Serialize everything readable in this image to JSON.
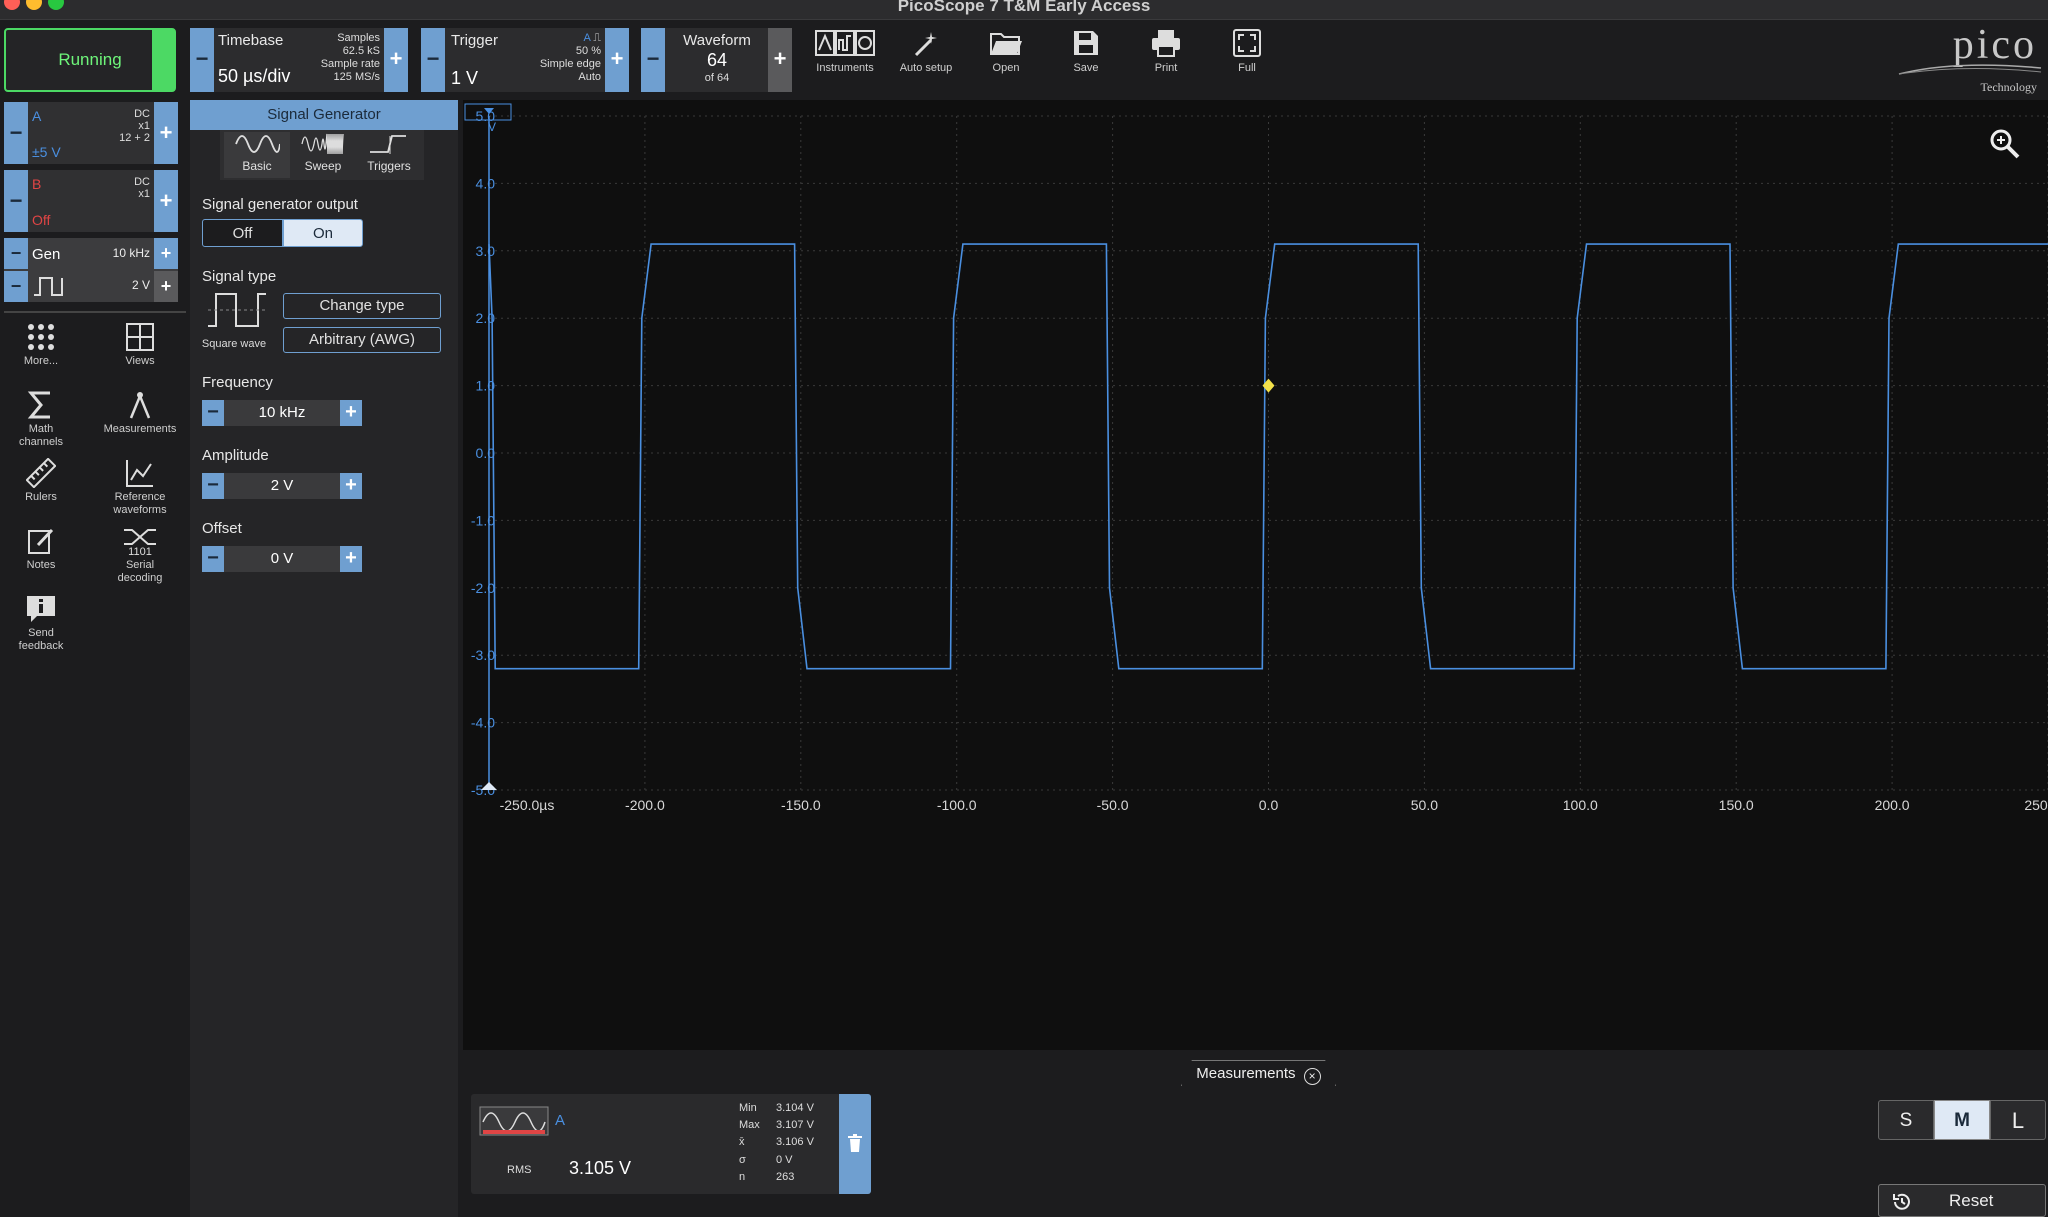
{
  "window": {
    "title": "PicoScope 7 T&M Early Access"
  },
  "toolbar": {
    "run_label": "Running",
    "timebase": {
      "title": "Timebase",
      "value": "50 µs/div",
      "samples_label": "Samples",
      "samples_value": "62.5 kS",
      "rate_label": "Sample rate",
      "rate_value": "125 MS/s"
    },
    "trigger": {
      "title": "Trigger",
      "value": "1 V",
      "channel": "A",
      "percent": "50 %",
      "type": "Simple edge",
      "mode": "Auto"
    },
    "waveform": {
      "title": "Waveform",
      "value": "64",
      "of": "of 64"
    },
    "tools": [
      {
        "label": "Instruments",
        "icon": "instruments-icon"
      },
      {
        "label": "Auto setup",
        "icon": "auto-setup-icon"
      },
      {
        "label": "Open",
        "icon": "open-folder-icon"
      },
      {
        "label": "Save",
        "icon": "save-icon"
      },
      {
        "label": "Print",
        "icon": "print-icon"
      },
      {
        "label": "Full",
        "icon": "fullscreen-icon"
      }
    ],
    "logo_text": "pico",
    "logo_sub": "Technology"
  },
  "channels": {
    "a": {
      "name": "A",
      "coupling": "DC",
      "probe": "x1",
      "res": "12 + 2",
      "range": "±5 V",
      "color": "#4a8fe0"
    },
    "b": {
      "name": "B",
      "coupling": "DC",
      "probe": "x1",
      "range": "Off",
      "color": "#e04545"
    },
    "gen": {
      "name": "Gen",
      "freq": "10 kHz",
      "amp": "2 V"
    }
  },
  "sidebar": {
    "items": [
      {
        "label": "More...",
        "icon": "more-icon"
      },
      {
        "label": "Views",
        "icon": "views-grid-icon"
      },
      {
        "label": "Math channels",
        "icon": "sigma-icon"
      },
      {
        "label": "Measurements",
        "icon": "measurements-icon"
      },
      {
        "label": "Rulers",
        "icon": "ruler-icon"
      },
      {
        "label": "Reference waveforms",
        "icon": "reference-waveform-icon"
      },
      {
        "label": "Notes",
        "icon": "notes-icon"
      },
      {
        "label": "Serial decoding",
        "icon": "serial-decoding-icon"
      },
      {
        "label": "Send feedback",
        "icon": "feedback-icon"
      }
    ]
  },
  "panel": {
    "title": "Signal Generator",
    "tabs": [
      "Basic",
      "Sweep",
      "Triggers"
    ],
    "output_label": "Signal generator output",
    "output_off": "Off",
    "output_on": "On",
    "signal_type_label": "Signal type",
    "wave_caption": "Square wave",
    "change_type": "Change type",
    "arbitrary": "Arbitrary (AWG)",
    "frequency_label": "Frequency",
    "frequency": "10 kHz",
    "amplitude_label": "Amplitude",
    "amplitude": "2 V",
    "offset_label": "Offset",
    "offset": "0 V"
  },
  "chart_data": {
    "type": "line",
    "x_unit": "µs",
    "xlim": [
      -250,
      250
    ],
    "ylim": [
      -5,
      5
    ],
    "x_ticks": [
      "-250.0",
      "-200.0",
      "-150.0",
      "-100.0",
      "-50.0",
      "0.0",
      "50.0",
      "100.0",
      "150.0",
      "200.0",
      "250"
    ],
    "y_ticks": [
      "5.0",
      "4.0",
      "3.0",
      "2.0",
      "1.0",
      "0.0",
      "-1.0",
      "-2.0",
      "-3.0",
      "-4.0",
      "-5.0"
    ],
    "y_unit": "V",
    "trigger_marker": [
      0,
      1
    ],
    "series": [
      {
        "name": "A",
        "color": "#4a8fe0",
        "x": [
          -250,
          -249,
          -248,
          -202,
          -201,
          -198,
          -152,
          -151,
          -148,
          -102,
          -101,
          -98,
          -52,
          -51,
          -48,
          -2,
          -1,
          2,
          48,
          49,
          52,
          98,
          99,
          102,
          148,
          149,
          152,
          198,
          199,
          202,
          248,
          249,
          250
        ],
        "y": [
          3.1,
          2.0,
          -3.2,
          -3.2,
          2.0,
          3.1,
          3.1,
          -2.0,
          -3.2,
          -3.2,
          2.0,
          3.1,
          3.1,
          -2.0,
          -3.2,
          -3.2,
          2.0,
          3.1,
          3.1,
          -2.0,
          -3.2,
          -3.2,
          2.0,
          3.1,
          3.1,
          -2.0,
          -3.2,
          -3.2,
          2.0,
          3.1,
          3.1,
          3.1,
          3.1
        ]
      }
    ]
  },
  "bottom": {
    "measurements_tab": "Measurements",
    "card": {
      "channel": "A",
      "label": "RMS",
      "value": "3.105 V",
      "stats": [
        {
          "k": "Min",
          "v": "3.104 V"
        },
        {
          "k": "Max",
          "v": "3.107 V"
        },
        {
          "k": "x̄",
          "v": "3.106 V"
        },
        {
          "k": "σ",
          "v": "0 V"
        },
        {
          "k": "n",
          "v": "263"
        }
      ]
    },
    "sizes": [
      "S",
      "M",
      "L"
    ],
    "reset": "Reset"
  }
}
